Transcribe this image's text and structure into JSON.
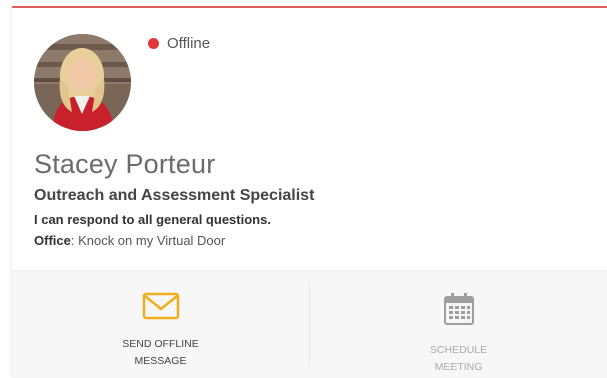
{
  "profile": {
    "status": "Offline",
    "name": "Stacey Porteur",
    "title": "Outreach and Assessment Specialist",
    "note": "I can respond to all general questions.",
    "office_label": "Office",
    "office_value": ": Knock on my Virtual Door"
  },
  "actions": {
    "send_offline_line1": "SEND OFFLINE",
    "send_offline_line2": "MESSAGE",
    "schedule_line1": "SCHEDULE",
    "schedule_line2": "MEETING"
  },
  "colors": {
    "accent_top": "#e35b5b",
    "status_offline": "#e0383a",
    "envelope_icon": "#f0ae1f",
    "calendar_icon": "#9e9e9e"
  },
  "icons": {
    "status": "status-dot",
    "send": "envelope-icon",
    "schedule": "calendar-icon"
  }
}
